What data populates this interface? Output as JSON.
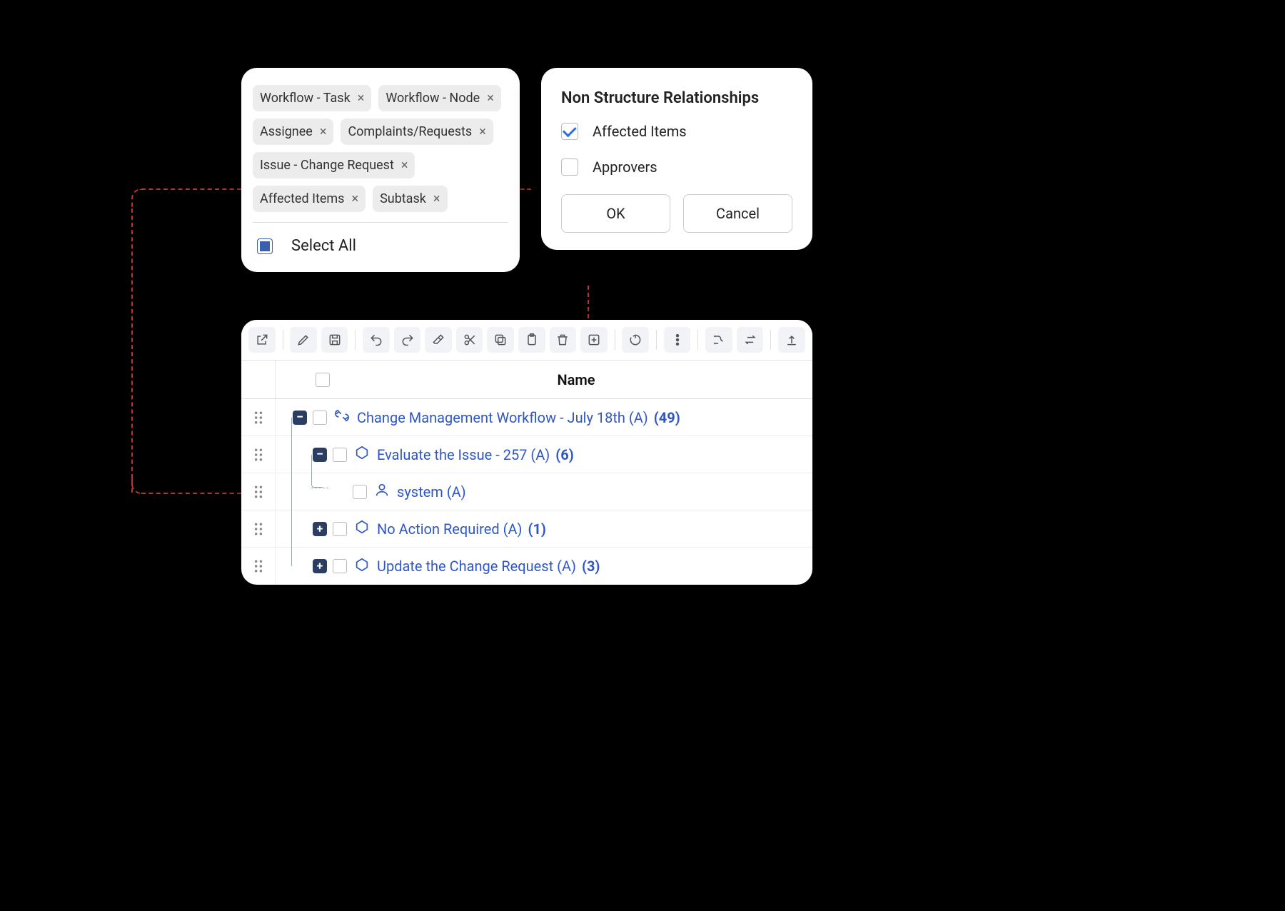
{
  "chips": {
    "items": [
      "Workflow - Task",
      "Workflow - Node",
      "Assignee",
      "Complaints/Requests",
      "Issue - Change Request",
      "Affected Items",
      "Subtask"
    ],
    "select_all_label": "Select All"
  },
  "relationships": {
    "title": "Non Structure Relationships",
    "options": [
      {
        "label": "Affected Items",
        "checked": true
      },
      {
        "label": "Approvers",
        "checked": false
      }
    ],
    "ok": "OK",
    "cancel": "Cancel"
  },
  "tree": {
    "header_name": "Name",
    "rows": [
      {
        "indent": 0,
        "toggle": "-",
        "icon": "workflow",
        "label": "Change Management Workflow - July 18th (A)",
        "count": "(49)"
      },
      {
        "indent": 1,
        "toggle": "-",
        "icon": "hex",
        "label": "Evaluate the Issue - 257 (A)",
        "count": "(6)"
      },
      {
        "indent": 2,
        "toggle": "",
        "icon": "user",
        "label": "system (A)",
        "count": "",
        "dashed": true
      },
      {
        "indent": 1,
        "toggle": "+",
        "icon": "hex",
        "label": "No Action Required (A)",
        "count": "(1)"
      },
      {
        "indent": 1,
        "toggle": "+",
        "icon": "hex",
        "label": "Update the Change Request (A)",
        "count": "(3)"
      }
    ]
  },
  "toolbar_icons": [
    "open-external-icon",
    "edit-icon",
    "save-icon",
    "undo-icon",
    "redo-icon",
    "erase-icon",
    "cut-icon",
    "copy-icon",
    "paste-icon",
    "delete-icon",
    "add-icon",
    "revert-icon",
    "more-icon",
    "flow-icon",
    "swap-icon",
    "upload-icon"
  ]
}
